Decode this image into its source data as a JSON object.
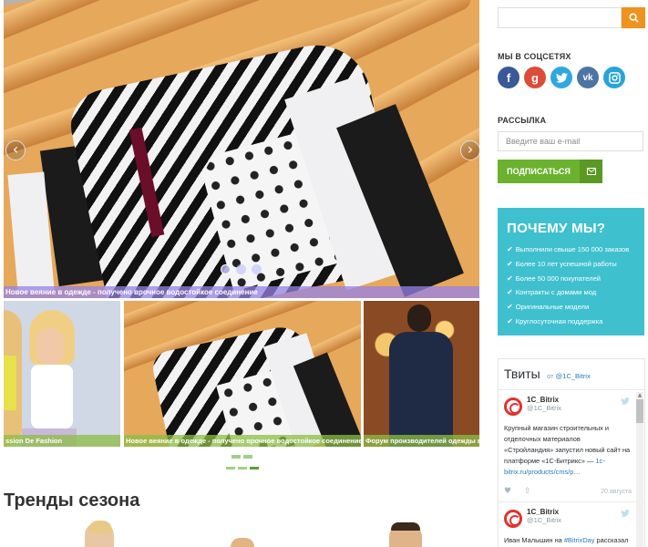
{
  "slider": {
    "caption": "Новое веяние в одежде - получено врочное водостойкое соединение",
    "prev_icon": "chevron-left-icon",
    "next_icon": "chevron-right-icon",
    "dots_count": 3,
    "active_dot": 1
  },
  "thumbnails": [
    {
      "caption": "ssion De Fashion"
    },
    {
      "caption": "Новое веяние в одежде - получено врочное водостойкое соединение"
    },
    {
      "caption": "Форум производителей одежды в Е"
    }
  ],
  "trends": {
    "title": "Тренды сезона"
  },
  "search": {
    "placeholder": "",
    "icon": "search-icon"
  },
  "social": {
    "heading": "МЫ В СОЦСЕТЯХ",
    "items": [
      {
        "name": "facebook",
        "glyph": "f",
        "color": "#3b5998"
      },
      {
        "name": "google-plus",
        "glyph": "g",
        "color": "#dd4b39"
      },
      {
        "name": "twitter",
        "glyph": "t",
        "color": "#2fa8e0"
      },
      {
        "name": "vk",
        "glyph": "vk",
        "color": "#4c75a3"
      },
      {
        "name": "instagram",
        "glyph": "◎",
        "color": "#29a4d9"
      }
    ]
  },
  "newsletter": {
    "heading": "РАССЫЛКА",
    "placeholder": "Введите ваш e-mail",
    "button_label": "ПОДПИСАТЬСЯ"
  },
  "why_us": {
    "title": "ПОЧЕМУ МЫ?",
    "items": [
      "Выполнили свыше 150 000 заказов",
      "Более 10 лет успешной работы",
      "Более 50 000 покупателей",
      "Контракты с домами мод",
      "Оригинальные модели",
      "Круглосуточная поддержка"
    ]
  },
  "tweets": {
    "title": "Твиты",
    "by_prefix": "от",
    "by_handle": "@1C_Bitrix",
    "items": [
      {
        "name": "1C_Bitrix",
        "handle": "@1C_Bitrix",
        "text_before": "Крупный магазин строительных и отделочных материалов «Стройландия» запустил новый сайт на платформе «1С-Битрикс» — ",
        "link": "1c-bitrix.ru/products/cms/p…",
        "date": "20 августа"
      },
      {
        "name": "1C_Bitrix",
        "handle": "@1C_Bitrix",
        "text_before": "Иван Малышин на ",
        "link": "#BitrixDay",
        "text_after": " рассказал про очень важные"
      }
    ]
  },
  "colors": {
    "accent_orange": "#f0921e",
    "green": "#6bb22e",
    "teal": "#3fc0cf"
  }
}
